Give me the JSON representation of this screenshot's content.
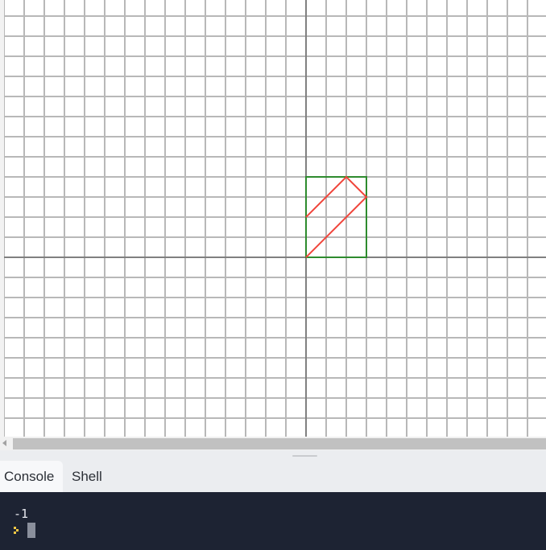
{
  "canvas": {
    "grid_color": "#b8b8b8",
    "axis_color": "#808080",
    "square": {
      "color": "#2e8b2e",
      "vertices": [
        [
          0,
          0
        ],
        [
          3,
          0
        ],
        [
          3,
          4
        ],
        [
          0,
          4
        ]
      ]
    },
    "red_path": {
      "color": "#f0443a",
      "points": [
        [
          0,
          0
        ],
        [
          3,
          3
        ],
        [
          2,
          4
        ],
        [
          0,
          2
        ]
      ]
    }
  },
  "tabs": {
    "console_label": "Console",
    "shell_label": "Shell"
  },
  "console": {
    "output_line": "-1",
    "prompt_icon": "chevron-prompt-icon",
    "prompt_color": "#f2c744",
    "background": "#1d2333"
  }
}
